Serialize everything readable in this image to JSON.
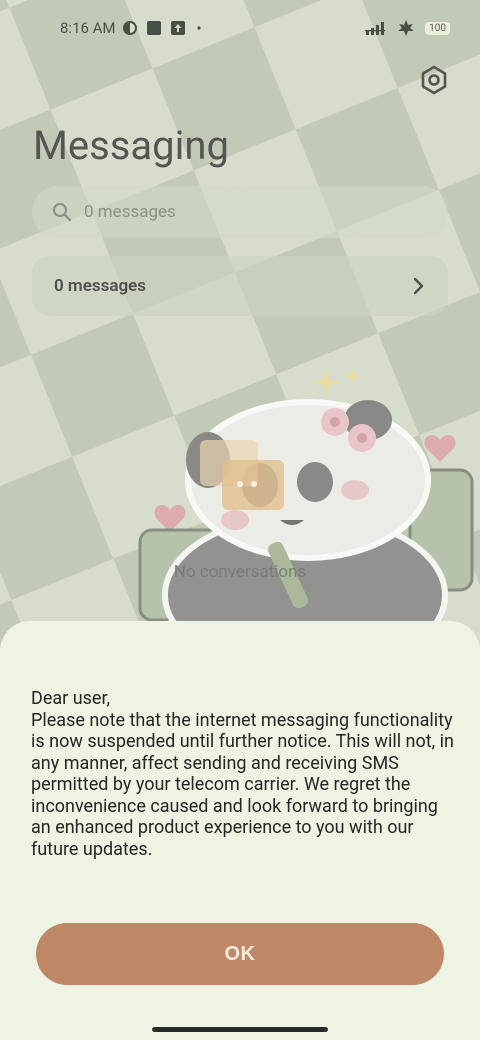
{
  "status_bar": {
    "time": "8:16 AM",
    "battery": "100"
  },
  "app": {
    "title": "Messaging"
  },
  "search": {
    "placeholder": "0 messages"
  },
  "summary_card": {
    "label": "0 messages"
  },
  "empty_state": {
    "text": "No conversations"
  },
  "dialog": {
    "message": "Dear user,\nPlease note that the internet messaging functionality is now suspended until further notice. This will not, in any manner, affect sending and receiving SMS permitted by your telecom carrier. We regret the inconvenience caused and look forward to bringing an enhanced product experience to you with our future updates.",
    "ok_label": "OK"
  },
  "colors": {
    "accent": "#bf8866",
    "sheet": "#eef4e4"
  }
}
